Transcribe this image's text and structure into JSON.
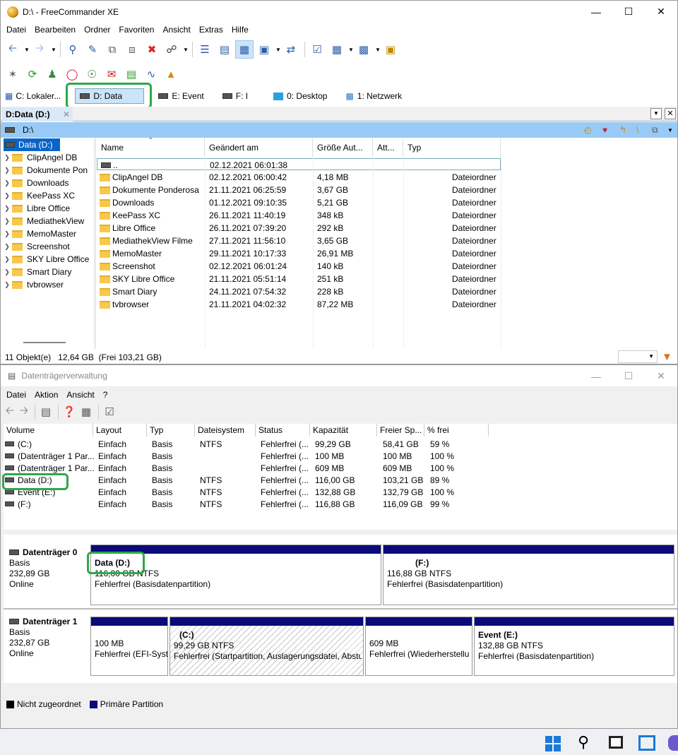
{
  "fc": {
    "title": "D:\\ - FreeCommander XE",
    "menu": [
      "Datei",
      "Bearbeiten",
      "Ordner",
      "Favoriten",
      "Ansicht",
      "Extras",
      "Hilfe"
    ],
    "drive_tabs": [
      {
        "label": "C: Lokaler..."
      },
      {
        "label": "D: Data"
      },
      {
        "label": "E: Event"
      },
      {
        "label": "F: I"
      },
      {
        "label": "0: Desktop"
      },
      {
        "label": "1: Netzwerk"
      }
    ],
    "panel_tab": "D:Data (D:)",
    "path": "D:\\",
    "tree_root": "Data (D:)",
    "tree": [
      "ClipAngel DB",
      "Dokumente Pon",
      "Downloads",
      "KeePass XC",
      "Libre Office",
      "MediathekView",
      "MemoMaster",
      "Screenshot",
      "SKY Libre Office",
      "Smart Diary",
      "tvbrowser"
    ],
    "columns": [
      "Name",
      "Geändert am",
      "Größe Aut...",
      "Att...",
      "Typ"
    ],
    "files": [
      {
        "name": "..",
        "date": "02.12.2021 06:01:38",
        "size": "",
        "type": ""
      },
      {
        "name": "ClipAngel DB",
        "date": "02.12.2021 06:00:42",
        "size": "4,18 MB",
        "type": "Dateiordner"
      },
      {
        "name": "Dokumente Ponderosa",
        "date": "21.11.2021 06:25:59",
        "size": "3,67 GB",
        "type": "Dateiordner"
      },
      {
        "name": "Downloads",
        "date": "01.12.2021 09:10:35",
        "size": "5,21 GB",
        "type": "Dateiordner"
      },
      {
        "name": "KeePass XC",
        "date": "26.11.2021 11:40:19",
        "size": "348 kB",
        "type": "Dateiordner"
      },
      {
        "name": "Libre Office",
        "date": "26.11.2021 07:39:20",
        "size": "292 kB",
        "type": "Dateiordner"
      },
      {
        "name": "MediathekView Filme",
        "date": "27.11.2021 11:56:10",
        "size": "3,65 GB",
        "type": "Dateiordner"
      },
      {
        "name": "MemoMaster",
        "date": "29.11.2021 10:17:33",
        "size": "26,91 MB",
        "type": "Dateiordner"
      },
      {
        "name": "Screenshot",
        "date": "02.12.2021 06:01:24",
        "size": "140 kB",
        "type": "Dateiordner"
      },
      {
        "name": "SKY Libre Office",
        "date": "21.11.2021 05:51:14",
        "size": "251 kB",
        "type": "Dateiordner"
      },
      {
        "name": "Smart Diary",
        "date": "24.11.2021 07:54:32",
        "size": "228 kB",
        "type": "Dateiordner"
      },
      {
        "name": "tvbrowser",
        "date": "21.11.2021 04:02:32",
        "size": "87,22 MB",
        "type": "Dateiordner"
      }
    ],
    "status": "11 Objekt(e)   12,64 GB  (Frei 103,21 GB)"
  },
  "dm": {
    "title": "Datenträgerverwaltung",
    "menu": [
      "Datei",
      "Aktion",
      "Ansicht",
      "?"
    ],
    "columns": [
      "Volume",
      "Layout",
      "Typ",
      "Dateisystem",
      "Status",
      "Kapazität",
      "Freier Sp...",
      "% frei"
    ],
    "volumes": [
      {
        "v": "(C:)",
        "l": "Einfach",
        "t": "Basis",
        "fs": "NTFS",
        "s": "Fehlerfrei (...",
        "k": "99,29 GB",
        "f": "58,41 GB",
        "p": "59 %"
      },
      {
        "v": "(Datenträger 1 Par...",
        "l": "Einfach",
        "t": "Basis",
        "fs": "",
        "s": "Fehlerfrei (...",
        "k": "100 MB",
        "f": "100 MB",
        "p": "100 %"
      },
      {
        "v": "(Datenträger 1 Par...",
        "l": "Einfach",
        "t": "Basis",
        "fs": "",
        "s": "Fehlerfrei (...",
        "k": "609 MB",
        "f": "609 MB",
        "p": "100 %"
      },
      {
        "v": "Data (D:)",
        "l": "Einfach",
        "t": "Basis",
        "fs": "NTFS",
        "s": "Fehlerfrei (...",
        "k": "116,00 GB",
        "f": "103,21 GB",
        "p": "89 %"
      },
      {
        "v": "Event (E:)",
        "l": "Einfach",
        "t": "Basis",
        "fs": "NTFS",
        "s": "Fehlerfrei (...",
        "k": "132,88 GB",
        "f": "132,79 GB",
        "p": "100 %"
      },
      {
        "v": "(F:)",
        "l": "Einfach",
        "t": "Basis",
        "fs": "NTFS",
        "s": "Fehlerfrei (...",
        "k": "116,88 GB",
        "f": "116,09 GB",
        "p": "99 %"
      }
    ],
    "disk0": {
      "name": "Datenträger 0",
      "type": "Basis",
      "size": "232,89 GB",
      "state": "Online",
      "parts": [
        {
          "title": "Data  (D:)",
          "size": "116,00 GB NTFS",
          "status": "Fehlerfrei (Basisdatenpartition)"
        },
        {
          "title": "(F:)",
          "size": "116,88 GB NTFS",
          "status": "Fehlerfrei (Basisdatenpartition)"
        }
      ]
    },
    "disk1": {
      "name": "Datenträger 1",
      "type": "Basis",
      "size": "232,87 GB",
      "state": "Online",
      "parts": [
        {
          "title": "",
          "size": "100 MB",
          "status": "Fehlerfrei (EFI-Syst"
        },
        {
          "title": "(C:)",
          "size": "99,29 GB NTFS",
          "status": "Fehlerfrei (Startpartition, Auslagerungsdatei, Abstu"
        },
        {
          "title": "",
          "size": "609 MB",
          "status": "Fehlerfrei (Wiederherstellu"
        },
        {
          "title": "Event  (E:)",
          "size": "132,88 GB NTFS",
          "status": "Fehlerfrei (Basisdatenpartition)"
        }
      ]
    },
    "legend": [
      "Nicht zugeordnet",
      "Primäre Partition"
    ],
    "colors": {
      "unallocated": "#000000",
      "primary": "#0a0a7a",
      "highlight": "#2ea84a"
    }
  }
}
